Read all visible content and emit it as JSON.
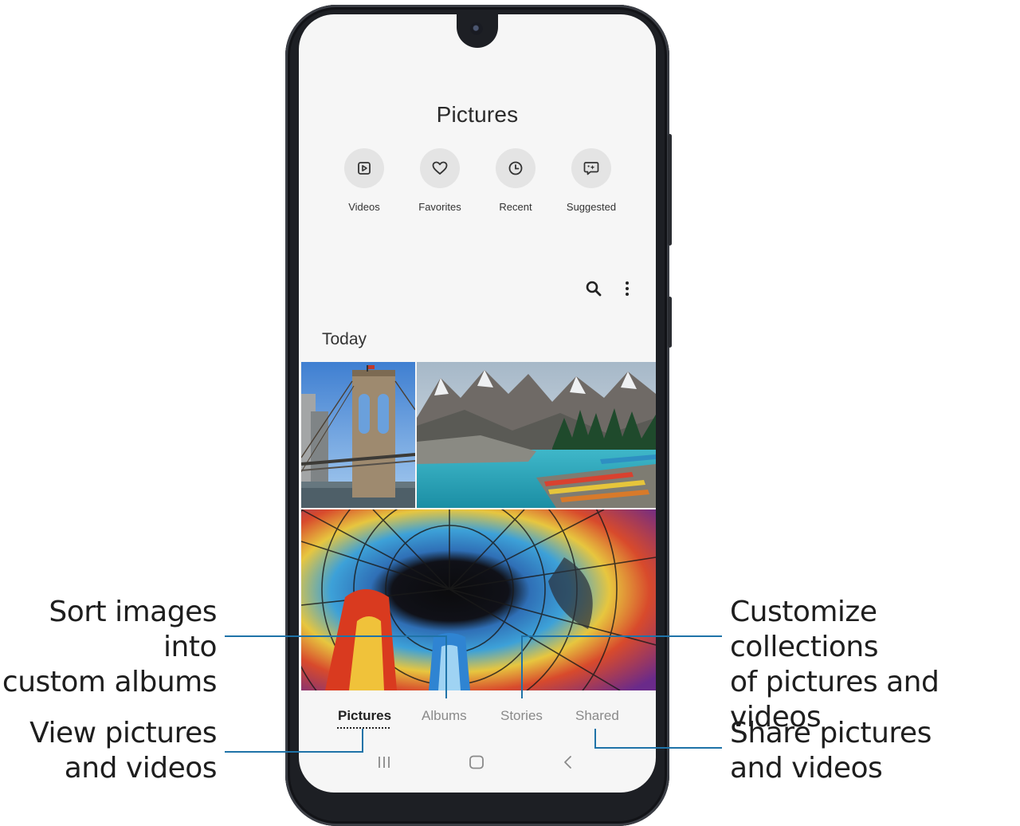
{
  "gallery": {
    "title": "Pictures",
    "quick_actions": [
      {
        "label": "Videos",
        "icon": "play-square-icon"
      },
      {
        "label": "Favorites",
        "icon": "heart-icon"
      },
      {
        "label": "Recent",
        "icon": "clock-icon"
      },
      {
        "label": "Suggested",
        "icon": "sparkle-chat-icon"
      }
    ],
    "toolbar": {
      "search_icon": "search-icon",
      "more_icon": "more-vertical-icon"
    },
    "section_title": "Today",
    "photos": [
      {
        "subject": "bridge",
        "icon": "photo-thumbnail"
      },
      {
        "subject": "mountain-lake",
        "icon": "photo-thumbnail"
      },
      {
        "subject": "stained-glass-dome",
        "icon": "photo-thumbnail"
      }
    ],
    "tabs": [
      {
        "label": "Pictures",
        "active": true
      },
      {
        "label": "Albums",
        "active": false
      },
      {
        "label": "Stories",
        "active": false
      },
      {
        "label": "Shared",
        "active": false
      }
    ],
    "nav": {
      "recents_icon": "recent-apps-icon",
      "home_icon": "home-icon",
      "back_icon": "back-icon"
    }
  },
  "callouts": {
    "albums_line1": "Sort images into",
    "albums_line2": "custom albums",
    "pictures_line1": "View pictures",
    "pictures_line2": "and videos",
    "stories_line1": "Customize collections",
    "stories_line2": "of pictures and videos",
    "shared_line1": "Share pictures",
    "shared_line2": "and videos"
  },
  "colors": {
    "leader_line": "#1f73a8",
    "phone_body": "#1d1f24",
    "screen_bg": "#f6f6f6"
  }
}
